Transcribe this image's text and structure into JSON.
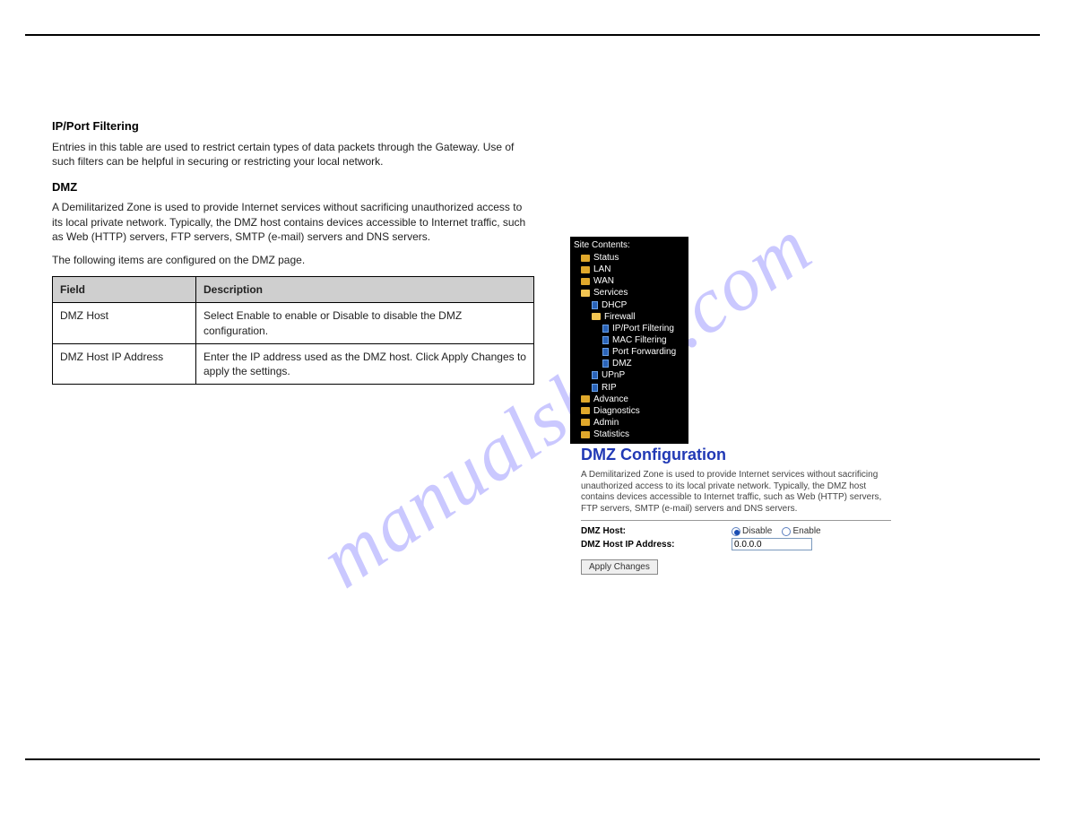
{
  "watermark": "manualshive.com",
  "left": {
    "h_ipport": "IP/Port Filtering",
    "p_ipport": "Entries in this table are used to restrict certain types of data packets through the Gateway. Use of such filters can be helpful in securing or restricting your local network.",
    "h_dmz": "DMZ",
    "p_dmz": "A Demilitarized Zone is used to provide Internet services without sacrificing unauthorized access to its local private network. Typically, the DMZ host contains devices accessible to Internet traffic, such as Web (HTTP) servers, FTP servers, SMTP (e-mail) servers and DNS servers.",
    "p_fields": "The following items are configured on the DMZ page."
  },
  "table": {
    "th1": "Field",
    "th2": "Description",
    "r1c1": "DMZ Host",
    "r1c2": "Select Enable to enable or Disable to disable the DMZ configuration.",
    "r2c1": "DMZ Host IP Address",
    "r2c2": "Enter the IP address used as the DMZ host. Click Apply Changes to apply the settings."
  },
  "shot": {
    "nav_title": "Site Contents:",
    "items": {
      "status": "Status",
      "lan": "LAN",
      "wan": "WAN",
      "services": "Services",
      "dhcp": "DHCP",
      "firewall": "Firewall",
      "ipport": "IP/Port Filtering",
      "mac": "MAC Filtering",
      "portfw": "Port Forwarding",
      "dmz": "DMZ",
      "upnp": "UPnP",
      "rip": "RIP",
      "advance": "Advance",
      "diag": "Diagnostics",
      "admin": "Admin",
      "stats": "Statistics"
    },
    "title": "DMZ Configuration",
    "desc": "A Demilitarized Zone is used to provide Internet services without sacrificing unauthorized access to its local private network. Typically, the DMZ host contains devices accessible to Internet traffic, such as Web (HTTP) servers, FTP servers, SMTP (e-mail) servers and DNS servers.",
    "lbl_host": "DMZ Host:",
    "lbl_ip": "DMZ Host IP Address:",
    "opt_disable": "Disable",
    "opt_enable": "Enable",
    "ip_value": "0.0.0.0",
    "btn_apply": "Apply Changes"
  }
}
